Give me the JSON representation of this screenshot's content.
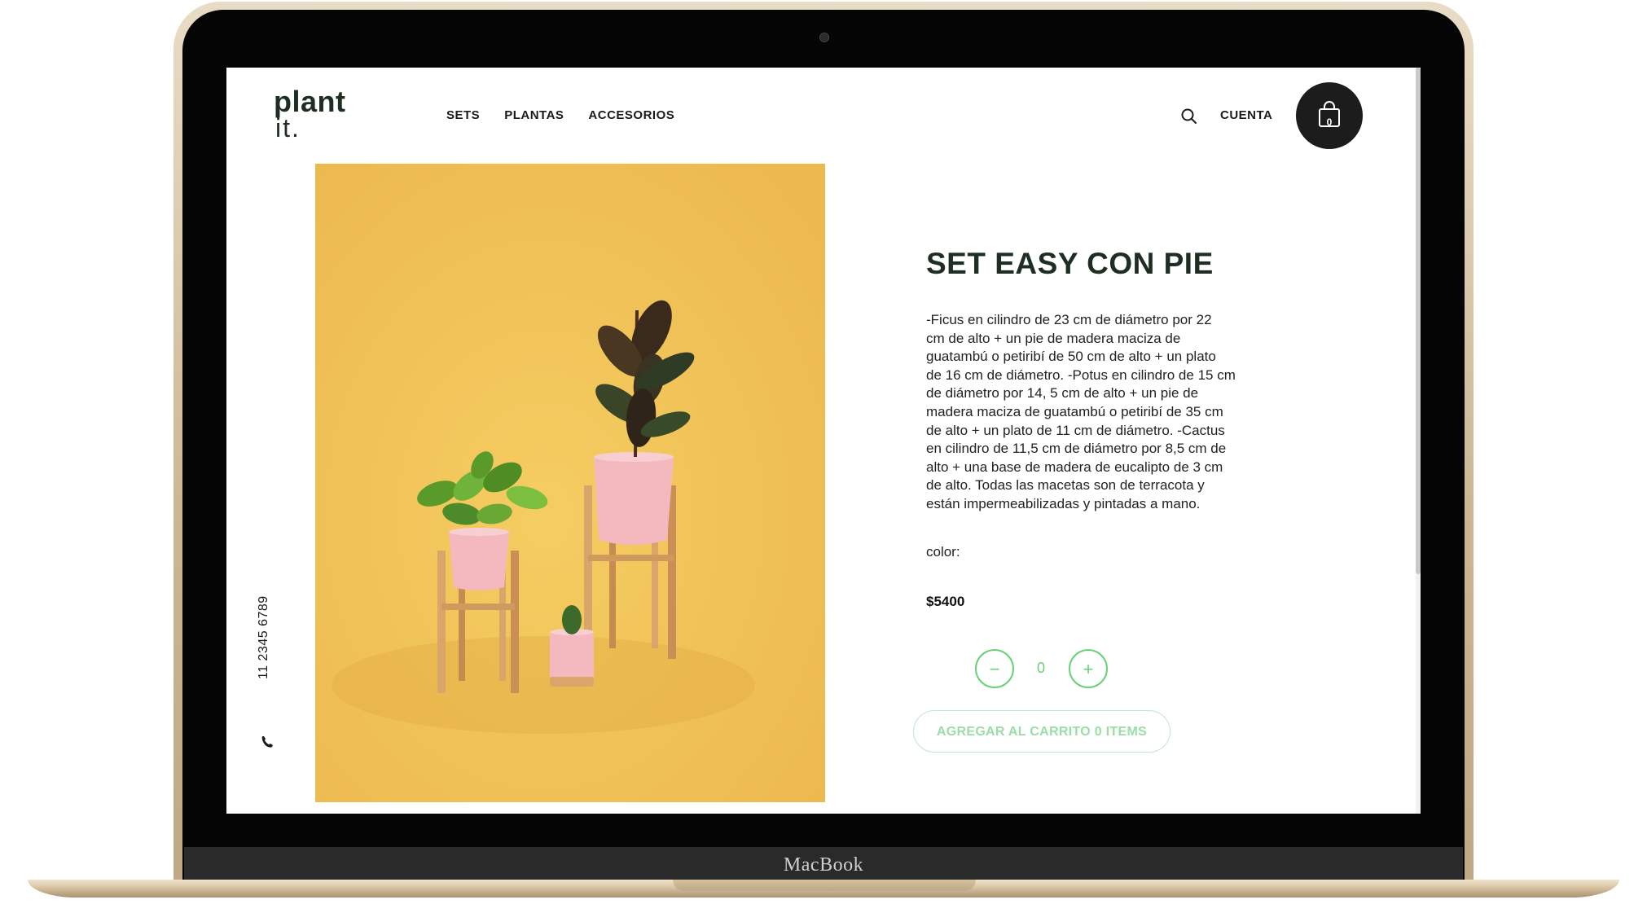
{
  "device": {
    "brand": "MacBook"
  },
  "header": {
    "logo_line1": "plant",
    "logo_line2": "it.",
    "nav": [
      "SETS",
      "PLANTAS",
      "ACCESORIOS"
    ],
    "account": "CUENTA",
    "cart_count": "0"
  },
  "sidebar": {
    "phone": "11 2345 6789"
  },
  "product": {
    "title": "SET EASY CON PIE",
    "description_lines": [
      "-Ficus en cilindro de 23 cm de diámetro por 22",
      "cm de alto + un pie de madera maciza de",
      "guatambú o petiribí de 50 cm de alto + un plato",
      "de 16 cm de diámetro. -Potus en cilindro de 15 cm",
      "de diámetro por 14, 5 cm de alto + un pie de",
      "madera maciza de guatambú o petiribí de 35 cm",
      "de alto + un plato de 11 cm de diámetro. -Cactus",
      "en cilindro de 11,5 cm de diámetro por 8,5 cm de",
      "alto + una base de madera de eucalipto de 3 cm",
      "de alto. Todas las macetas son de terracota y",
      "están impermeabilizadas y pintadas a mano."
    ],
    "color_label": "color:",
    "price": "$5400",
    "quantity": "0",
    "minus_label": "−",
    "plus_label": "+",
    "add_to_cart": "AGREGAR AL CARRITO 0 ITEMS"
  },
  "colors": {
    "dark_green": "#1f2e22",
    "accent_green": "#6ad07a",
    "image_background": "#f1c45a",
    "pot_pink": "#f4b9bf"
  },
  "icons": [
    "search-icon",
    "bag-icon",
    "phone-icon"
  ]
}
